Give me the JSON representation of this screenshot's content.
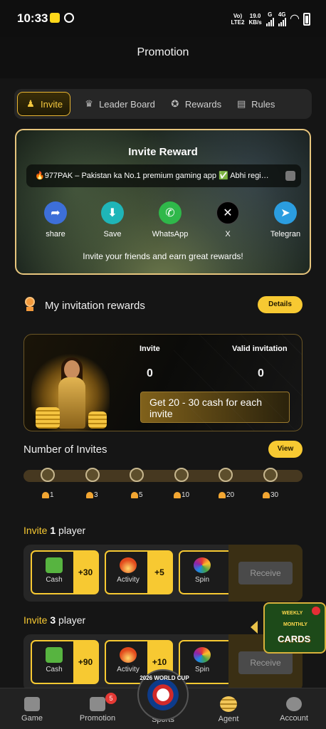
{
  "status": {
    "time": "10:33",
    "net_top": "Vo)",
    "net_bottom": "LTE2",
    "speed_top": "19.0",
    "speed_bottom": "KB/s",
    "g_label": "G",
    "lte_label": "4G"
  },
  "header": {
    "title": "Promotion"
  },
  "tabs": [
    {
      "label": "Invite",
      "icon": "invite-person-icon",
      "active": true
    },
    {
      "label": "Leader Board",
      "icon": "trophy-icon",
      "active": false
    },
    {
      "label": "Rewards",
      "icon": "medal-icon",
      "active": false
    },
    {
      "label": "Rules",
      "icon": "document-icon",
      "active": false
    }
  ],
  "invite_card": {
    "title": "Invite Reward",
    "marquee": "🔥977PAK – Pakistan ka No.1 premium gaming app ✅ Abhi regi…",
    "share": [
      {
        "label": "share",
        "icon": "share-icon",
        "color": "#3d6fd8"
      },
      {
        "label": "Save",
        "icon": "download-icon",
        "color": "#1fb5b8"
      },
      {
        "label": "WhatsApp",
        "icon": "whatsapp-icon",
        "color": "#2fb84a"
      },
      {
        "label": "X",
        "icon": "x-icon",
        "color": "#000000"
      },
      {
        "label": "Telegran",
        "icon": "telegram-icon",
        "color": "#2b9de0"
      }
    ],
    "footer": "Invite your friends and earn great rewards!"
  },
  "my_rewards": {
    "title": "My invitation rewards",
    "details_label": "Details",
    "invite_label": "Invite",
    "invite_value": "0",
    "valid_label": "Valid invitation",
    "valid_value": "0",
    "cash_text": "Get 20 - 30 cash for each invite"
  },
  "invites": {
    "title": "Number of Invites",
    "view_label": "View",
    "milestones": [
      "1",
      "3",
      "5",
      "10",
      "20",
      "30"
    ]
  },
  "tiers": [
    {
      "prefix": "Invite",
      "count": "1",
      "suffix": "player",
      "rewards": [
        {
          "label": "Cash",
          "value": "+30",
          "icon": "cash-icon"
        },
        {
          "label": "Activity",
          "value": "+5",
          "icon": "fire-icon"
        },
        {
          "label": "Spin",
          "value": "",
          "icon": "spin-wheel-icon"
        }
      ],
      "receive_label": "Receive"
    },
    {
      "prefix": "Invite",
      "count": "3",
      "suffix": "player",
      "rewards": [
        {
          "label": "Cash",
          "value": "+90",
          "icon": "cash-icon"
        },
        {
          "label": "Activity",
          "value": "+10",
          "icon": "fire-icon"
        },
        {
          "label": "Spin",
          "value": "",
          "icon": "spin-wheel-icon"
        }
      ],
      "receive_label": "Receive"
    }
  ],
  "promo_cards": {
    "weekly": "WEEKLY",
    "monthly": "MONTHLY",
    "cards": "CARDS"
  },
  "bottom_nav": {
    "items": [
      {
        "label": "Game",
        "icon": "gamepad-icon"
      },
      {
        "label": "Promotion",
        "icon": "gift-icon",
        "badge": "5"
      },
      {
        "label": "Sports",
        "icon": "world-cup-icon"
      },
      {
        "label": "Agent",
        "icon": "coin-stack-icon"
      },
      {
        "label": "Account",
        "icon": "user-icon"
      }
    ],
    "world_cup_text": "2026 WORLD CUP"
  }
}
